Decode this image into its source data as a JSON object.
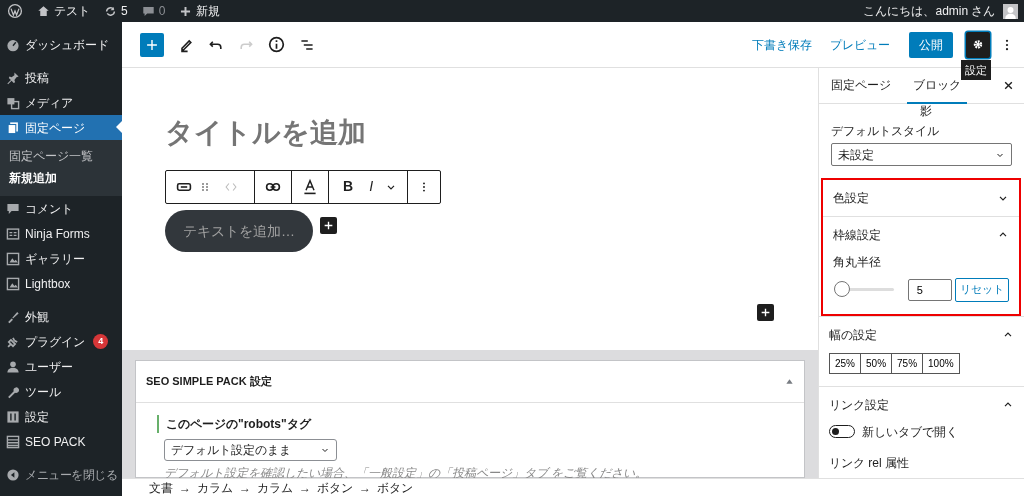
{
  "admin_bar": {
    "site": "テスト",
    "updates": "5",
    "comments": "0",
    "new": "新規",
    "greeting": "こんにちは、admin さん"
  },
  "menu": {
    "groups": [
      [
        {
          "label": "ダッシュボード",
          "selected": false
        }
      ],
      [
        {
          "label": "投稿",
          "selected": false
        },
        {
          "label": "メディア",
          "selected": false
        },
        {
          "label": "固定ページ",
          "selected": true,
          "children": [
            {
              "label": "固定ページ一覧",
              "selected": false
            },
            {
              "label": "新規追加",
              "selected": true
            }
          ]
        },
        {
          "label": "コメント",
          "selected": false
        },
        {
          "label": "Ninja Forms",
          "selected": false
        },
        {
          "label": "ギャラリー",
          "selected": false
        },
        {
          "label": "Lightbox",
          "selected": false
        }
      ],
      [
        {
          "label": "外観",
          "selected": false
        },
        {
          "label": "プラグイン",
          "selected": false,
          "badge": "4"
        },
        {
          "label": "ユーザー",
          "selected": false
        },
        {
          "label": "ツール",
          "selected": false
        },
        {
          "label": "設定",
          "selected": false
        },
        {
          "label": "SEO PACK",
          "selected": false
        }
      ]
    ],
    "collapse": "メニューを閉じる"
  },
  "header": {
    "redo_disabled": true,
    "save_draft": "下書き保存",
    "preview": "プレビュー",
    "publish": "公開",
    "settings_pressed": true,
    "tooltip": "設定"
  },
  "canvas": {
    "title_placeholder": "タイトルを追加",
    "bold": "B",
    "italic": "I",
    "button_placeholder": "テキストを追加…"
  },
  "meta_box": {
    "title": "SEO SIMPLE PACK 設定",
    "field_label": "このページの\"robots\"タグ",
    "select_value": "デフォルト設定のまま",
    "hint_before": "デフォルト設定を確認したい場合、",
    "hint_link": "「一般設定」の「投稿ページ」タブ",
    "hint_after": " をご覧ください。"
  },
  "breadcrumb": {
    "separator": "→",
    "items": [
      "文書",
      "カラム",
      "カラム",
      "ボタン",
      "ボタン"
    ]
  },
  "settings_sidebar": {
    "tabs": [
      {
        "label": "固定ページ",
        "selected": false
      },
      {
        "label": "ブロック",
        "selected": true
      }
    ],
    "cut_label": "影",
    "default_style": {
      "label": "デフォルトスタイル",
      "value": "未設定"
    },
    "panels": [
      {
        "kind": "plain",
        "title": "色設定",
        "expanded": false,
        "highlighted": true
      },
      {
        "kind": "radius",
        "title": "枠線設定",
        "expanded": true,
        "highlighted": true,
        "label": "角丸半径",
        "level": 0.05,
        "value": "5",
        "reset": "リセット"
      },
      {
        "kind": "widths",
        "title": "幅の設定",
        "expanded": true,
        "highlighted": false,
        "options": [
          "25%",
          "50%",
          "75%",
          "100%"
        ]
      },
      {
        "kind": "link",
        "title": "リンク設定",
        "expanded": true,
        "highlighted": false,
        "toggle_label": "新しいタブで開く",
        "on": false,
        "rel_label": "リンク rel 属性"
      }
    ]
  }
}
